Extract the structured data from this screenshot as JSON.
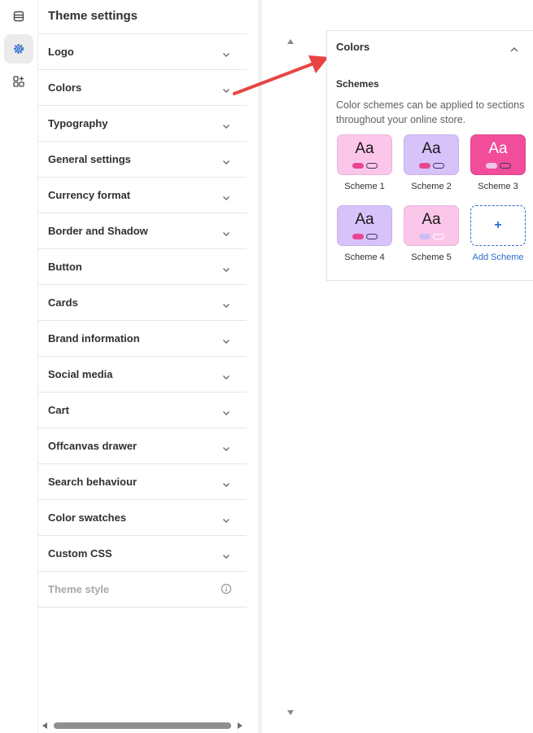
{
  "sidebar_rail": {
    "items": [
      {
        "icon": "sections-icon",
        "active": false
      },
      {
        "icon": "gear-icon",
        "active": true
      },
      {
        "icon": "apps-icon",
        "active": false
      }
    ]
  },
  "panel": {
    "title": "Theme settings",
    "items": [
      {
        "label": "Logo"
      },
      {
        "label": "Colors"
      },
      {
        "label": "Typography"
      },
      {
        "label": "General settings"
      },
      {
        "label": "Currency format"
      },
      {
        "label": "Border and Shadow"
      },
      {
        "label": "Button"
      },
      {
        "label": "Cards"
      },
      {
        "label": "Brand information"
      },
      {
        "label": "Social media"
      },
      {
        "label": "Cart"
      },
      {
        "label": "Offcanvas drawer"
      },
      {
        "label": "Search behaviour"
      },
      {
        "label": "Color swatches"
      },
      {
        "label": "Custom CSS"
      },
      {
        "label": "Theme style",
        "disabled": true
      }
    ]
  },
  "colors_panel": {
    "title": "Colors",
    "schemes_heading": "Schemes",
    "description": "Color schemes can be applied to sections throughout your online store.",
    "sample_text": "Aa",
    "schemes": [
      {
        "name": "Scheme 1",
        "bg": "#fcc6ea",
        "text": "#1a1a1a",
        "pill1": "#e8478f",
        "pill2": "#3a3a5c"
      },
      {
        "name": "Scheme 2",
        "bg": "#d8c2fa",
        "text": "#1a1a1a",
        "pill1": "#e8478f",
        "pill2": "#3a3a5c"
      },
      {
        "name": "Scheme 3",
        "bg": "#f14d9a",
        "text": "#ffffff",
        "pill1": "#f3c3e8",
        "pill2": "#3a3a5c"
      },
      {
        "name": "Scheme 4",
        "bg": "#d8c2fa",
        "text": "#1a1a1a",
        "pill1": "#e8478f",
        "pill2": "#3a3a5c"
      },
      {
        "name": "Scheme 5",
        "bg": "#fcc6ea",
        "text": "#1a1a1a",
        "pill1": "#cdbdf7",
        "pill2": "#ffffff"
      }
    ],
    "add_scheme_label": "Add Scheme",
    "add_icon": "+"
  },
  "colors": {
    "accent": "#2c6ecb",
    "annotation_arrow": "#e94444"
  }
}
